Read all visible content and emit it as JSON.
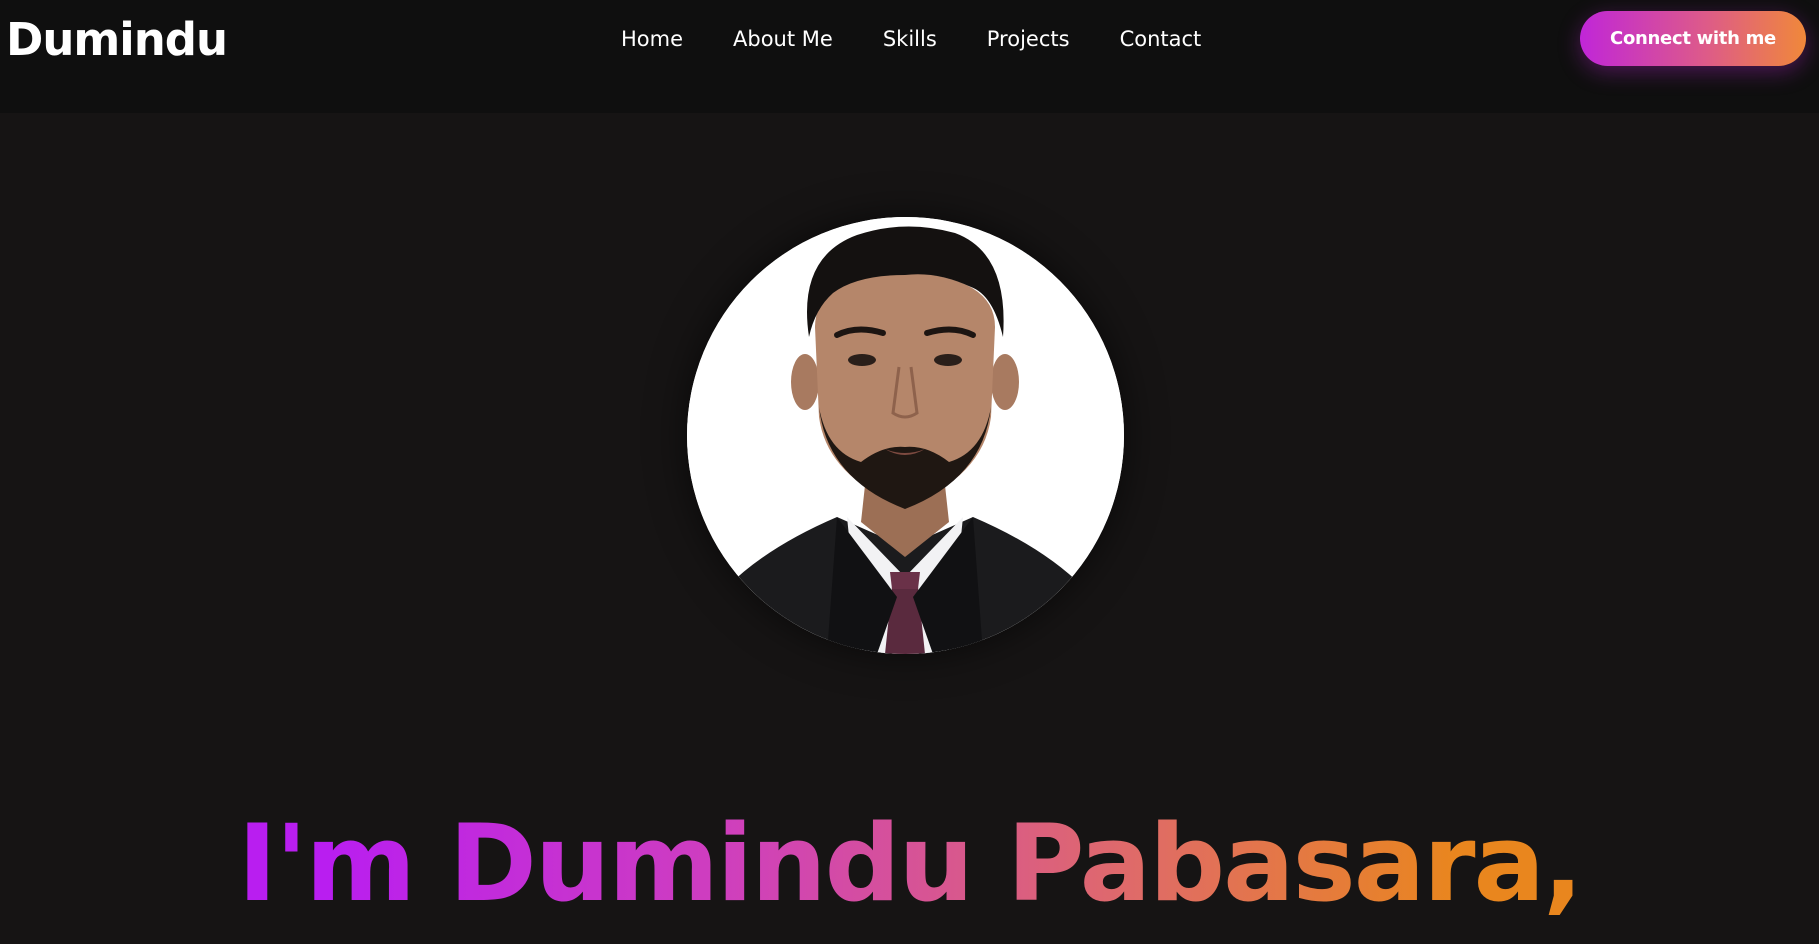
{
  "nav": {
    "logo": "Dumindu",
    "links": [
      "Home",
      "About Me",
      "Skills",
      "Projects",
      "Contact"
    ],
    "cta_label": "Connect with me"
  },
  "hero": {
    "headline": "I'm Dumindu Pabasara,"
  },
  "colors": {
    "background": "#161414",
    "navbar": "#0f0f0f",
    "gradient_start": "#c026d8",
    "gradient_end": "#f0883a"
  }
}
